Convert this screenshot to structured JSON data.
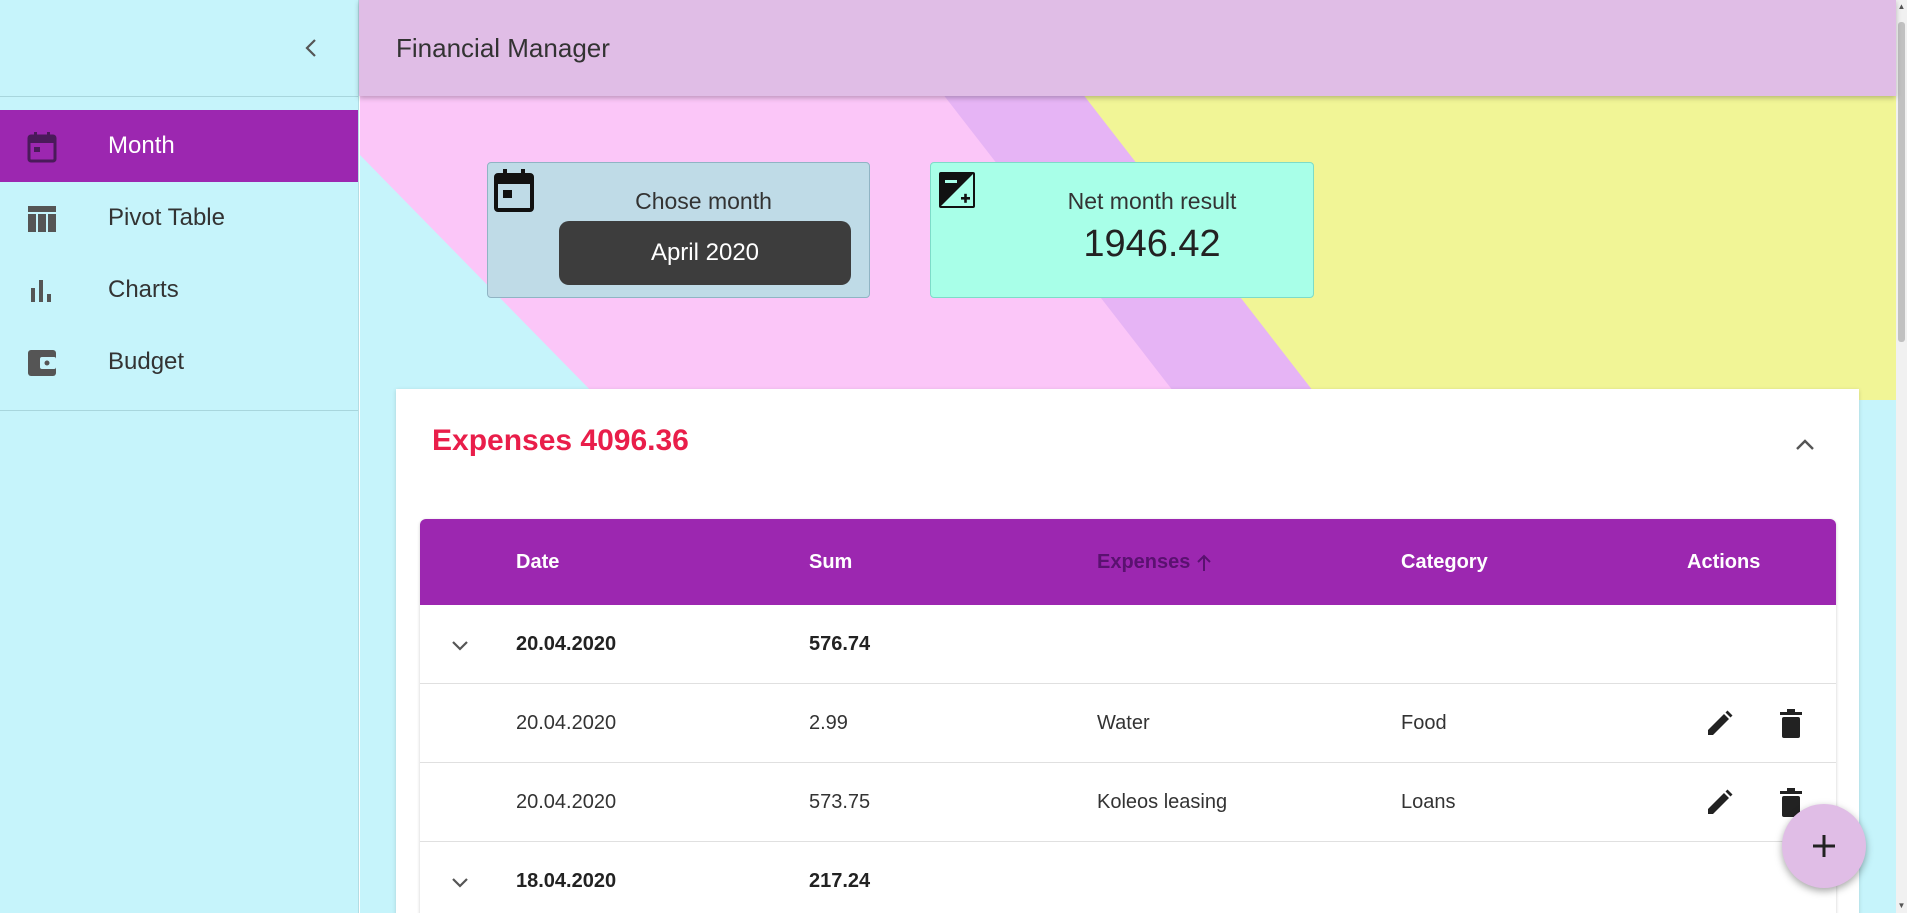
{
  "app": {
    "title": "Financial Manager"
  },
  "sidebar": {
    "items": [
      {
        "label": "Month",
        "icon": "calendar-icon",
        "active": true
      },
      {
        "label": "Pivot Table",
        "icon": "table-icon",
        "active": false
      },
      {
        "label": "Charts",
        "icon": "bar-chart-icon",
        "active": false
      },
      {
        "label": "Budget",
        "icon": "wallet-icon",
        "active": false
      }
    ]
  },
  "month_card": {
    "title": "Chose month",
    "value": "April 2020"
  },
  "net_card": {
    "title": "Net month result",
    "value": "1946.42"
  },
  "expenses": {
    "title": "Expenses 4096.36",
    "columns": {
      "date": "Date",
      "sum": "Sum",
      "expenses": "Expenses",
      "category": "Category",
      "actions": "Actions"
    },
    "rows": [
      {
        "type": "group",
        "date": "20.04.2020",
        "sum": "576.74"
      },
      {
        "type": "item",
        "date": "20.04.2020",
        "sum": "2.99",
        "expense": "Water",
        "category": "Food"
      },
      {
        "type": "item",
        "date": "20.04.2020",
        "sum": "573.75",
        "expense": "Koleos leasing",
        "category": "Loans"
      },
      {
        "type": "group",
        "date": "18.04.2020",
        "sum": "217.24"
      }
    ]
  },
  "colors": {
    "accent": "#9c27b0",
    "header": "#e0bde6",
    "sidebar": "#c6f4fb",
    "expense_title": "#e91e4a"
  }
}
